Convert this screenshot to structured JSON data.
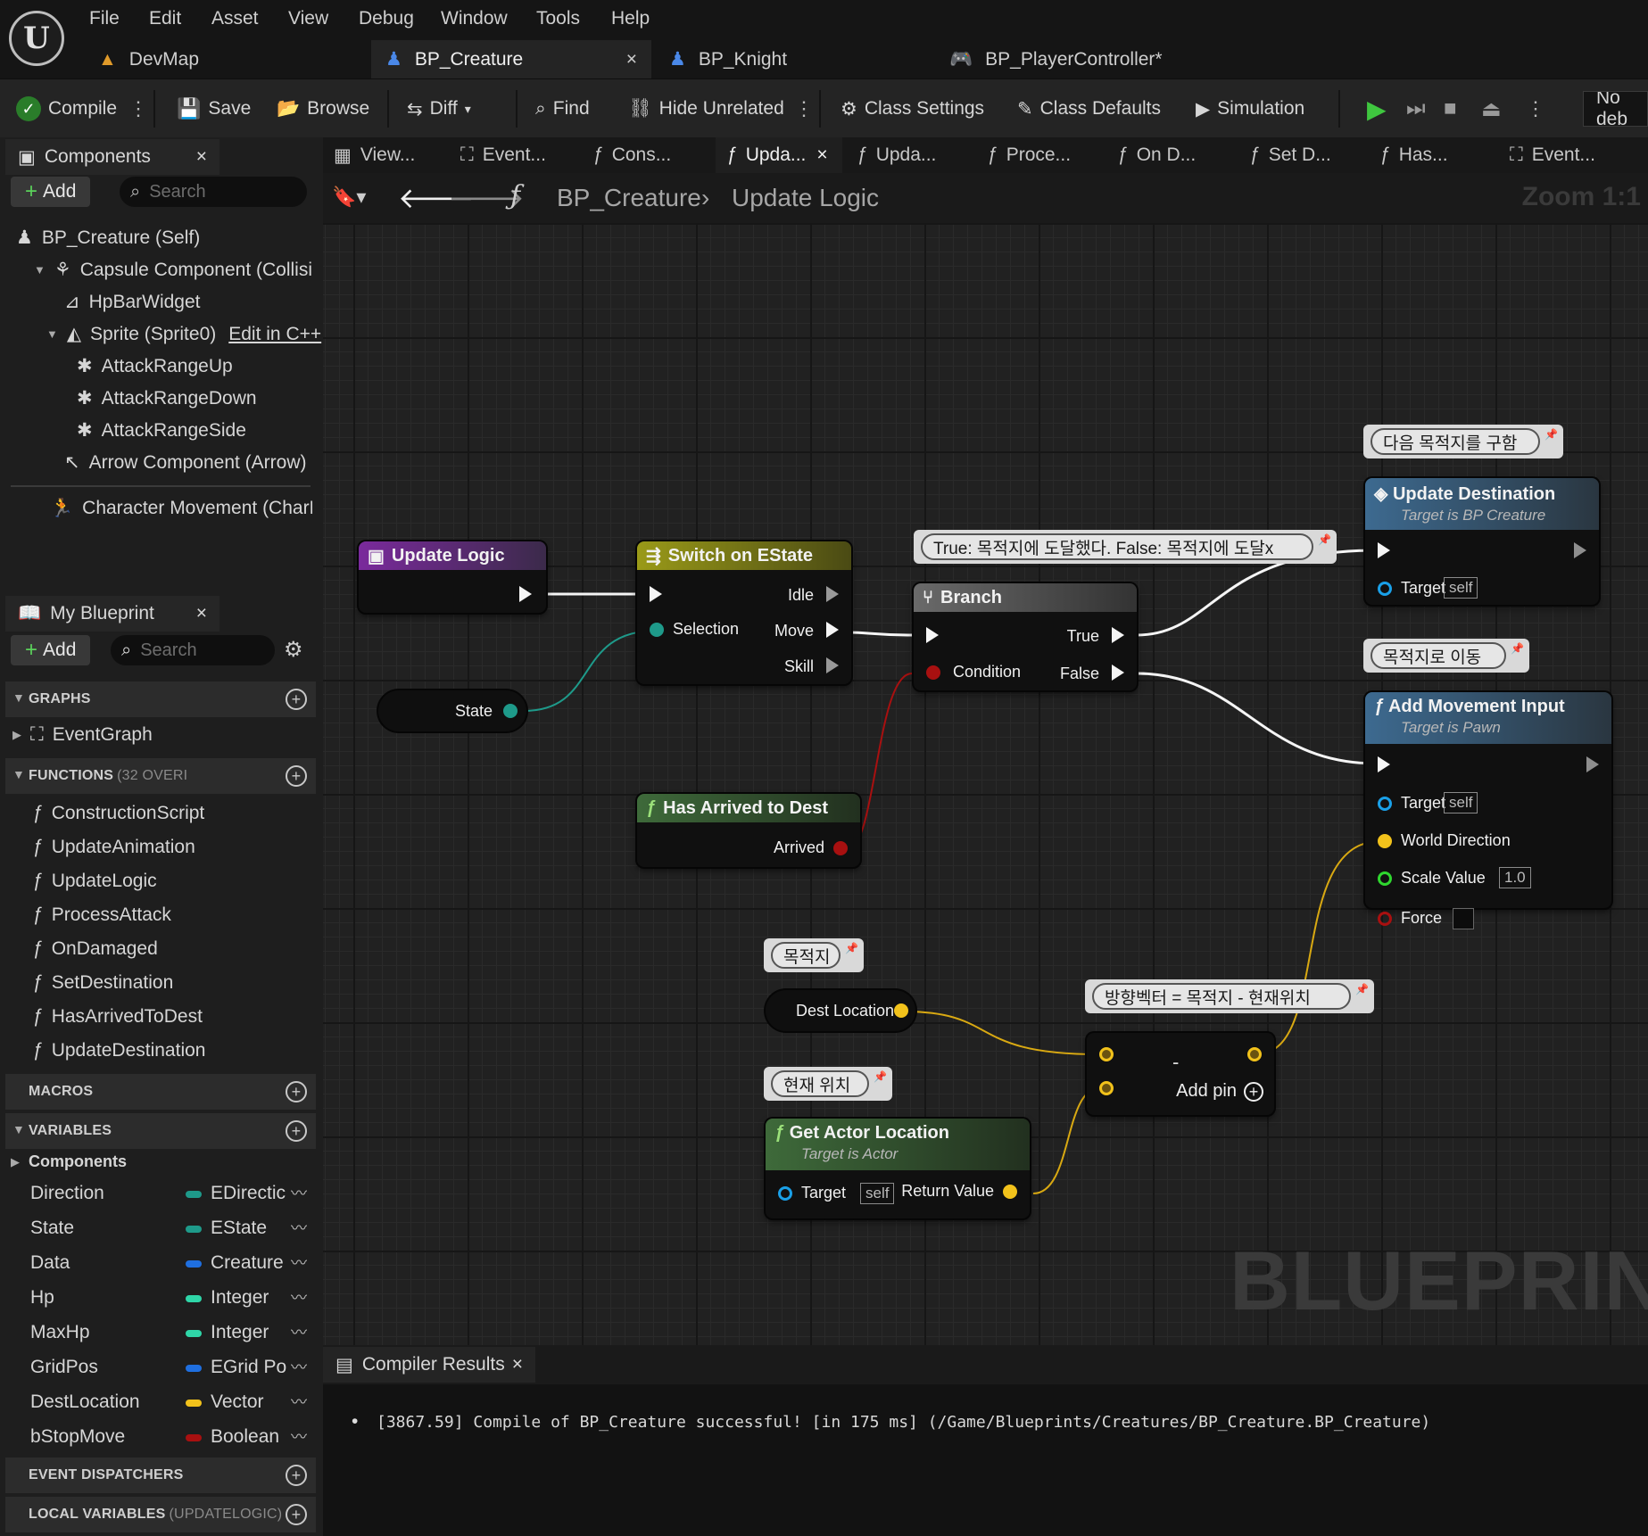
{
  "menu": [
    "File",
    "Edit",
    "Asset",
    "View",
    "Debug",
    "Window",
    "Tools",
    "Help"
  ],
  "doc_tabs": [
    {
      "label": "DevMap"
    },
    {
      "label": "BP_Creature",
      "close": "×"
    },
    {
      "label": "BP_Knight"
    },
    {
      "label": "BP_PlayerController*"
    }
  ],
  "toolbar": {
    "compile": "Compile",
    "save": "Save",
    "browse": "Browse",
    "diff": "Diff",
    "find": "Find",
    "hide_unrelated": "Hide Unrelated",
    "class_settings": "Class Settings",
    "class_defaults": "Class Defaults",
    "simulation": "Simulation",
    "debug_filter": "No deb"
  },
  "components": {
    "tab": "Components",
    "close": "×",
    "add": "Add",
    "search_placeholder": "Search",
    "tree": [
      "BP_Creature (Self)",
      "Capsule Component (Collisior",
      "HpBarWidget",
      "Sprite (Sprite0)",
      "AttackRangeUp",
      "AttackRangeDown",
      "AttackRangeSide",
      "Arrow Component (Arrow)",
      "Character Movement (CharM"
    ],
    "edit_cpp": "Edit in C++"
  },
  "my_blueprint": {
    "tab": "My Blueprint",
    "close": "×",
    "add": "Add",
    "search_placeholder": "Search",
    "graphs_header": "GRAPHS",
    "event_graph": "EventGraph",
    "functions_header": "FUNCTIONS",
    "functions_count": "(32 OVERI",
    "functions": [
      "ConstructionScript",
      "UpdateAnimation",
      "UpdateLogic",
      "ProcessAttack",
      "OnDamaged",
      "SetDestination",
      "HasArrivedToDest",
      "UpdateDestination"
    ],
    "macros_header": "MACROS",
    "variables_header": "VARIABLES",
    "components_category": "Components",
    "variables": [
      {
        "name": "Direction",
        "type": "EDirectic",
        "color": "#1e9a8a"
      },
      {
        "name": "State",
        "type": "EState",
        "color": "#1e9a8a"
      },
      {
        "name": "Data",
        "type": "Creature",
        "color": "#1f6fe0"
      },
      {
        "name": "Hp",
        "type": "Integer",
        "color": "#2fd6a8"
      },
      {
        "name": "MaxHp",
        "type": "Integer",
        "color": "#2fd6a8"
      },
      {
        "name": "GridPos",
        "type": "EGrid Po",
        "color": "#1f6fe0"
      },
      {
        "name": "DestLocation",
        "type": "Vector",
        "color": "#f2c21b"
      },
      {
        "name": "bStopMove",
        "type": "Boolean",
        "color": "#a81010"
      }
    ],
    "event_dispatchers_header": "EVENT DISPATCHERS",
    "local_variables_header": "LOCAL VARIABLES",
    "local_variables_scope": "(UPDATELOGIC)"
  },
  "graph_tabs": [
    "View...",
    "Event...",
    "Cons...",
    "Upda...",
    "Upda...",
    "Proce...",
    "On D...",
    "Set D...",
    "Has...",
    "Event..."
  ],
  "graph_tab_close": "×",
  "breadcrumb": {
    "root": "BP_Creature",
    "current": "Update Logic",
    "zoom": "Zoom 1:1"
  },
  "nodes": {
    "update_logic": {
      "title": "Update Logic"
    },
    "switch": {
      "title": "Switch on EState",
      "selection": "Selection",
      "idle": "Idle",
      "move": "Move",
      "skill": "Skill"
    },
    "state_var": {
      "label": "State"
    },
    "branch": {
      "title": "Branch",
      "true": "True",
      "false": "False",
      "condition": "Condition"
    },
    "branch_comment": "True: 목적지에 도달했다. False: 목적지에 도달x",
    "has_arrived": {
      "title": "Has Arrived to Dest",
      "arrived": "Arrived"
    },
    "update_dest": {
      "title": "Update Destination",
      "subtitle": "Target is BP Creature",
      "target": "Target",
      "self": "self"
    },
    "update_dest_comment": "다음 목적지를 구함",
    "add_movement": {
      "title": "Add Movement Input",
      "subtitle": "Target is Pawn",
      "target": "Target",
      "self": "self",
      "world_direction": "World Direction",
      "scale_value": "Scale Value",
      "scale_default": "1.0",
      "force": "Force"
    },
    "add_movement_comment": "목적지로 이동",
    "dest_var": {
      "label": "Dest Location"
    },
    "dest_comment": "목적지",
    "subtract": {
      "symbol": "-",
      "add_pin": "Add pin"
    },
    "subtract_comment": "방향벡터 = 목적지 - 현재위치",
    "get_actor_loc": {
      "title": "Get Actor Location",
      "subtitle": "Target is Actor",
      "target": "Target",
      "self": "self",
      "return": "Return Value"
    },
    "get_actor_comment": "현재 위치"
  },
  "watermark": "BLUEPRINT",
  "compiler": {
    "tab": "Compiler Results",
    "close": "×",
    "message": "[3867.59] Compile of BP_Creature successful! [in 175 ms] (/Game/Blueprints/Creatures/BP_Creature.BP_Creature)"
  },
  "colors": {
    "exec": "#f5f5f5",
    "vector": "#f2c21b",
    "bool": "#a81010",
    "object": "#1aa0e8",
    "float": "#2fd62f",
    "enum": "#1e9a8a"
  }
}
